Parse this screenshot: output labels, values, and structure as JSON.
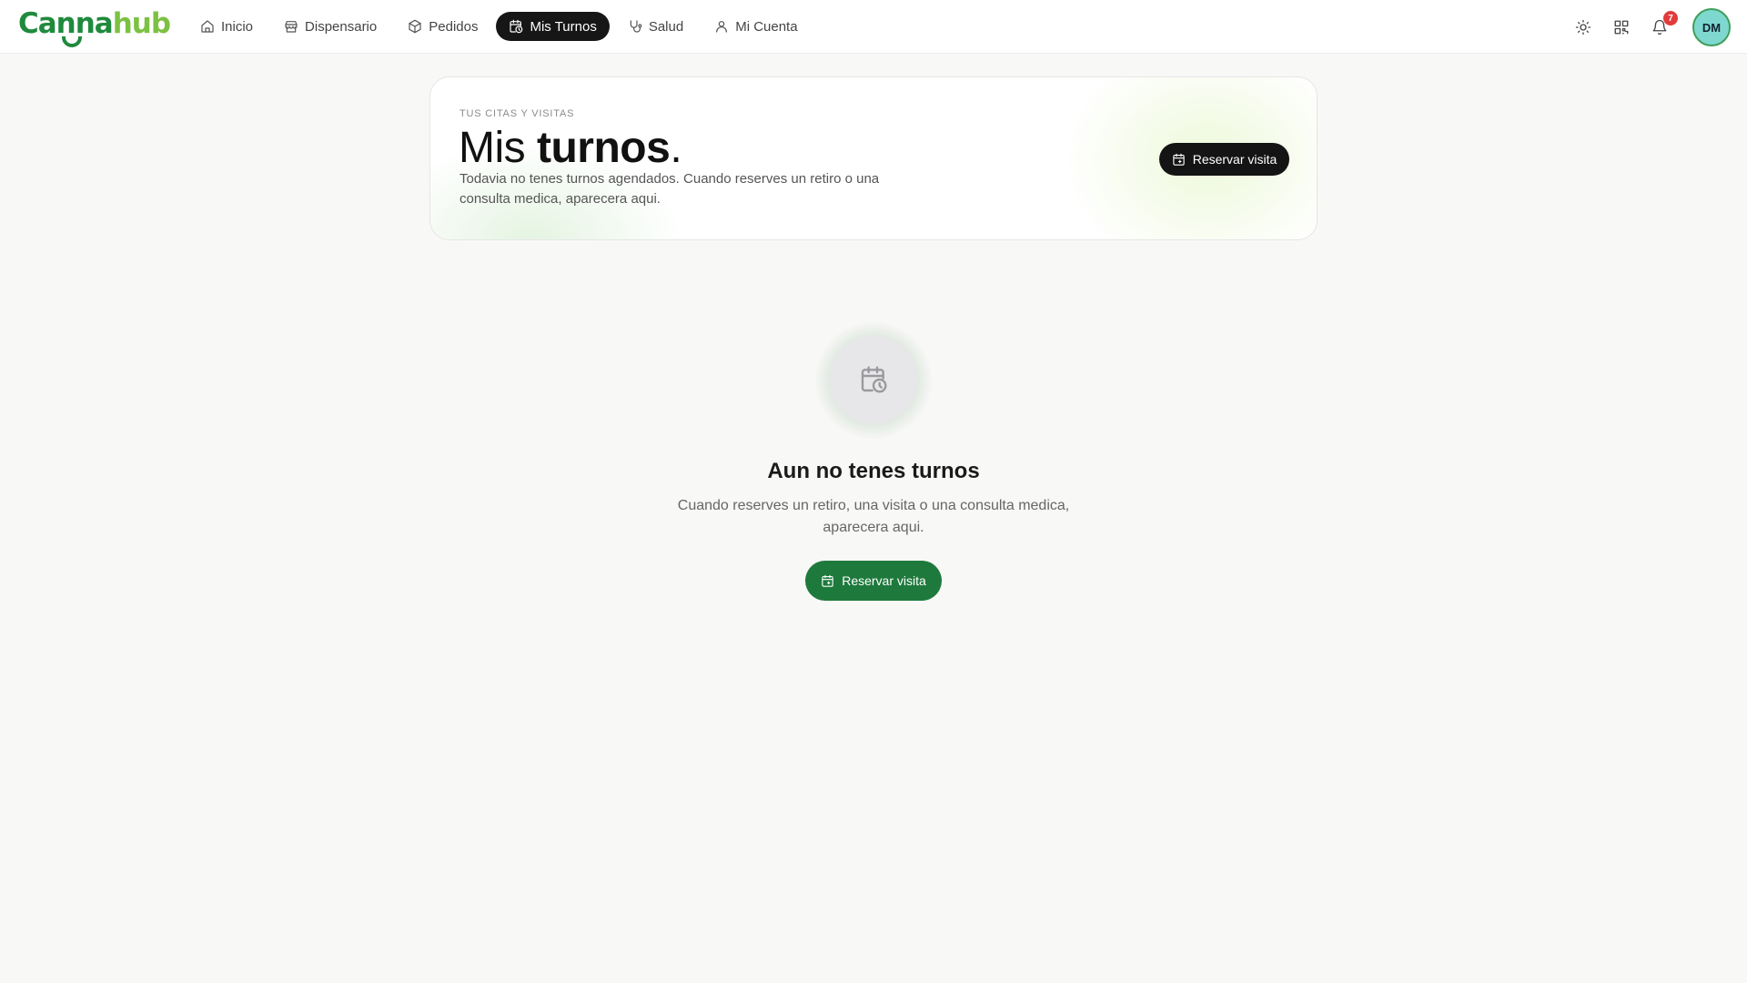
{
  "brand": {
    "part1": "Canna",
    "part2": "hub",
    "color_primary": "#1f8a3d",
    "color_secondary": "#7cc142"
  },
  "nav": {
    "items": [
      {
        "label": "Inicio",
        "icon": "home-icon"
      },
      {
        "label": "Dispensario",
        "icon": "store-icon"
      },
      {
        "label": "Pedidos",
        "icon": "package-icon"
      },
      {
        "label": "Mis Turnos",
        "icon": "calendar-clock-icon",
        "active": true
      },
      {
        "label": "Salud",
        "icon": "stethoscope-icon"
      },
      {
        "label": "Mi Cuenta",
        "icon": "user-icon"
      }
    ]
  },
  "toolbar": {
    "theme_icon": "sun-icon",
    "qr_icon": "qr-code-icon",
    "notifications_icon": "bell-icon",
    "notifications_count": "7",
    "avatar_initials": "DM"
  },
  "hero": {
    "eyebrow": "TUS CITAS Y VISITAS",
    "title_light": "Mis ",
    "title_bold": "turnos",
    "title_dot": ".",
    "description": "Todavia no tenes turnos agendados. Cuando reserves un retiro o una consulta medica, aparecera aqui.",
    "button_label": "Reservar visita"
  },
  "empty_state": {
    "icon": "calendar-clock-icon",
    "title": "Aun no tenes turnos",
    "description": "Cuando reserves un retiro, una visita o una consulta medica, aparecera aqui.",
    "button_label": "Reservar visita",
    "button_color": "#1e7a3c"
  }
}
